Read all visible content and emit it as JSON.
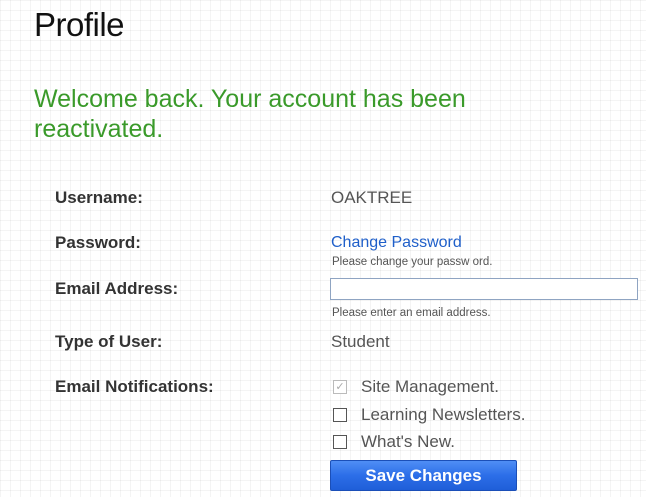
{
  "page": {
    "title": "Profile",
    "message": "Welcome back. Your account has been reactivated.",
    "message_color": "#3a9a2a"
  },
  "form": {
    "username": {
      "label": "Username:",
      "value": "OAKTREE"
    },
    "password": {
      "label": "Password:",
      "link": "Change Password",
      "hint": "Please change your passw ord."
    },
    "email": {
      "label": "Email Address:",
      "value": "",
      "placeholder": "",
      "hint": "Please enter an email address."
    },
    "user_type": {
      "label": "Type of User:",
      "value": "Student"
    },
    "notifications": {
      "label": "Email Notifications:",
      "options": [
        {
          "label": "Site Management.",
          "checked": true,
          "disabled": true
        },
        {
          "label": "Learning Newsletters.",
          "checked": false
        },
        {
          "label": "What's New.",
          "checked": false
        }
      ]
    },
    "save_label": "Save Changes"
  },
  "colors": {
    "link": "#1f5fc9",
    "button": "#2c6ee8"
  },
  "icons": {
    "checkmark": "check-icon"
  }
}
